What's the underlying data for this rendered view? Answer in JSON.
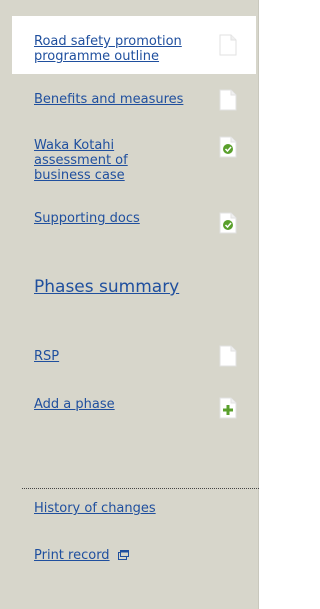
{
  "nav": {
    "items": [
      {
        "label": "Road safety promotion programme outline",
        "status": "blank"
      },
      {
        "label": "Benefits and measures",
        "status": "blank"
      },
      {
        "label": "Waka Kotahi assessment of business case",
        "status": "complete"
      },
      {
        "label": "Supporting docs",
        "status": "complete"
      }
    ]
  },
  "phases": {
    "heading": "Phases summary",
    "items": [
      {
        "label": "RSP",
        "status": "blank"
      },
      {
        "label": "Add a phase",
        "status": "add"
      }
    ]
  },
  "footer": {
    "history_label": "History of changes",
    "print_label": "Print record"
  },
  "colors": {
    "panel_bg": "#d7d6cb",
    "link": "#1f4f9e",
    "status_green": "#5aa02c"
  }
}
